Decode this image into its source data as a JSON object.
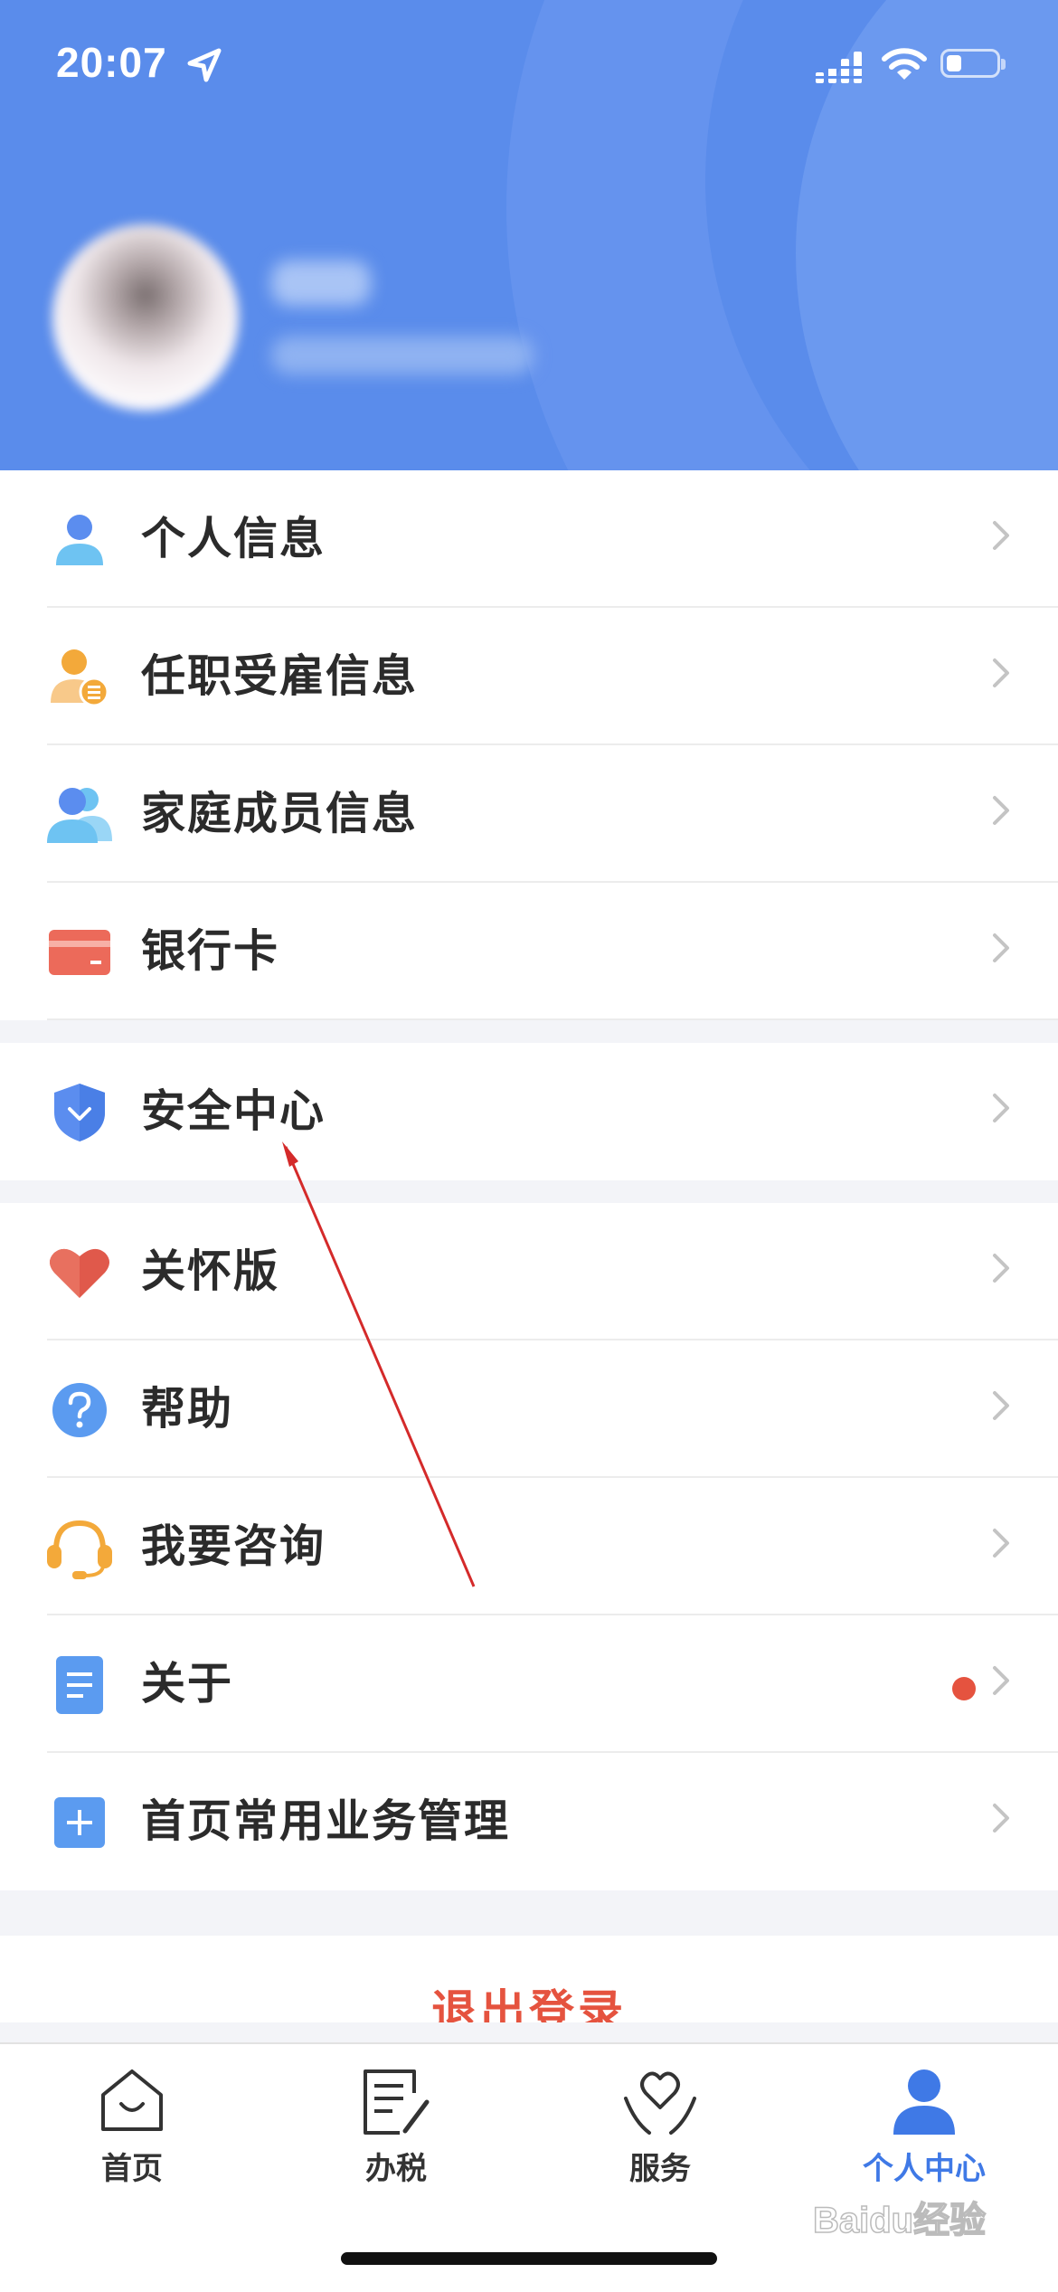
{
  "status_bar": {
    "time": "20:07"
  },
  "profile": {
    "name": "",
    "subtitle": ""
  },
  "menu_groups": [
    [
      {
        "label": "个人信息",
        "icon": "person-icon"
      },
      {
        "label": "任职受雇信息",
        "icon": "employment-icon"
      },
      {
        "label": "家庭成员信息",
        "icon": "family-icon"
      },
      {
        "label": "银行卡",
        "icon": "bank-card-icon"
      }
    ],
    [
      {
        "label": "安全中心",
        "icon": "shield-icon"
      }
    ],
    [
      {
        "label": "关怀版",
        "icon": "heart-icon"
      },
      {
        "label": "帮助",
        "icon": "help-icon"
      },
      {
        "label": "我要咨询",
        "icon": "headset-icon"
      },
      {
        "label": "关于",
        "icon": "document-icon",
        "badge": "red-dot"
      },
      {
        "label": "首页常用业务管理",
        "icon": "plus-square-icon"
      }
    ]
  ],
  "logout_label": "退出登录",
  "tabs": [
    {
      "label": "首页",
      "icon": "home-icon"
    },
    {
      "label": "办税",
      "icon": "tax-icon"
    },
    {
      "label": "服务",
      "icon": "service-icon"
    },
    {
      "label": "个人中心",
      "icon": "user-icon",
      "active": true
    }
  ],
  "watermark": "Baidu经验",
  "colors": {
    "accent": "#3f79e6",
    "header": "#5a8ceb",
    "danger": "#e5533f",
    "arrow": "#d42a2a"
  }
}
